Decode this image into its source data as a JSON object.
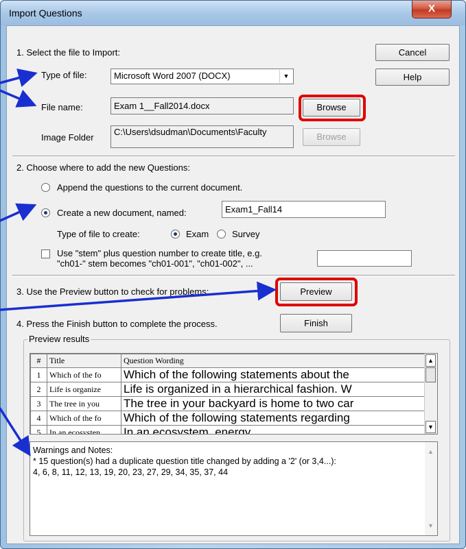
{
  "window": {
    "title": "Import Questions",
    "close_glyph": "X"
  },
  "step1": {
    "heading": "1.  Select the file to Import:",
    "type_label": "Type of file:",
    "type_value": "Microsoft Word 2007 (DOCX)",
    "filename_label": "File name:",
    "filename_value": "Exam 1__Fall2014.docx",
    "browse_label": "Browse",
    "image_folder_label": "Image Folder",
    "image_folder_value": "C:\\Users\\dsudman\\Documents\\Faculty",
    "image_browse_label": "Browse"
  },
  "buttons": {
    "cancel": "Cancel",
    "help": "Help"
  },
  "step2": {
    "heading": "2.  Choose where to add the new Questions:",
    "append_label": "Append the questions to the current document.",
    "create_label": "Create a new document, named:",
    "create_value": "Exam1_Fall14",
    "type_create_label": "Type of file to create:",
    "exam_label": "Exam",
    "survey_label": "Survey",
    "stem_line1": "Use \"stem\" plus question number to create title,  e.g.",
    "stem_line2": "\"ch01-\" stem becomes \"ch01-001\",  \"ch01-002\",  ...",
    "stem_value": ""
  },
  "step3": {
    "heading": "3.  Use the Preview button to check for problems:",
    "preview_label": "Preview"
  },
  "step4": {
    "heading": "4.  Press the Finish button to complete the process.",
    "finish_label": "Finish"
  },
  "preview": {
    "group_label": "Preview results",
    "columns": [
      "#",
      "Title",
      "Question Wording"
    ],
    "rows": [
      {
        "num": "1",
        "title": "Which of the fo",
        "wording": "Which of the following statements about the"
      },
      {
        "num": "2",
        "title": "Life is organize",
        "wording": "Life is organized in a hierarchical fashion. W"
      },
      {
        "num": "3",
        "title": "The tree in you",
        "wording": "The tree in your backyard is home to two car"
      },
      {
        "num": "4",
        "title": "Which of the fo",
        "wording": "Which of the following statements regarding"
      },
      {
        "num": "5",
        "title": "In an ecosysten",
        "wording": "In an ecosystem, energy"
      }
    ]
  },
  "notes": {
    "line1": "Warnings and Notes:",
    "line2": "* 15 question(s) had a duplicate question title changed by adding a '2' (or 3,4...):",
    "line3": "4, 6, 8, 11, 12, 13, 19, 20, 23, 27, 29, 34, 35, 37, 44"
  },
  "colors": {
    "highlight": "#e00000",
    "arrow": "#1a2fd0",
    "dialog": "#f0f0f0"
  }
}
